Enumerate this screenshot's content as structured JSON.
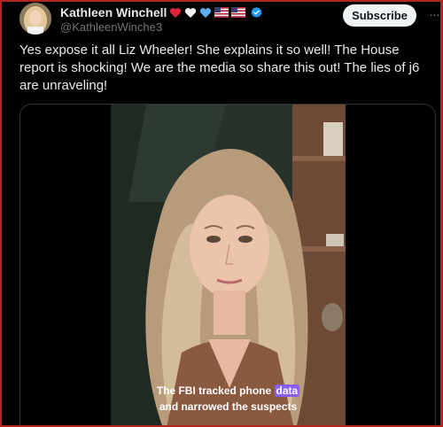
{
  "author": {
    "display_name": "Kathleen Winchell",
    "handle": "@KathleenWinche3",
    "name_emojis": [
      "red-heart-emoji",
      "white-heart-emoji",
      "blue-heart-emoji",
      "us-flag-emoji",
      "us-flag-emoji"
    ],
    "verified": true
  },
  "header": {
    "subscribe_label": "Subscribe",
    "more_icon": "more-icon"
  },
  "post": {
    "text": "Yes expose it all Liz Wheeler! She explains it so well! The House report is shocking! We are the media so share this out! The lies of j6 are unraveling!"
  },
  "video": {
    "caption_line1_pre": "The FBI tracked phone ",
    "caption_line1_highlight": "data",
    "caption_line2": "and narrowed the suspects"
  },
  "colors": {
    "background": "#000000",
    "text": "#e7e9ea",
    "secondary_text": "#71767b",
    "verified_blue": "#1d9bf0",
    "subscribe_bg": "#eff3f4",
    "caption_highlight": "#8b5cf6",
    "frame_border": "#b3261e"
  }
}
